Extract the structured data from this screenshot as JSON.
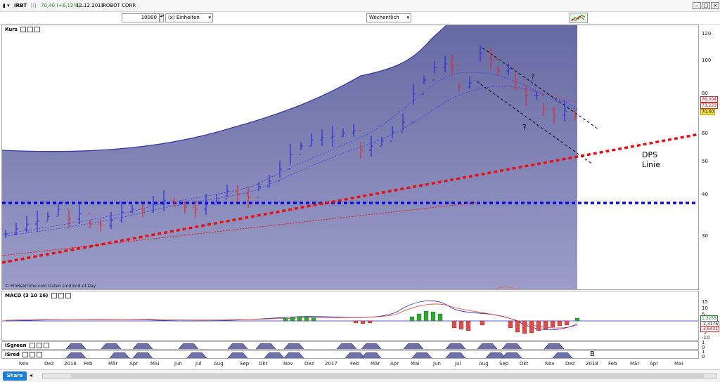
{
  "header": {
    "symbol": "IRBT",
    "price_change": "70,40 (+6,12%)",
    "date": "12.12.2017",
    "company": "IROBOT CORP."
  },
  "toolbar": {
    "quantity": "10000",
    "unit": "(x) Einheiten",
    "period": "Wöchentlich"
  },
  "panels": {
    "price_title": "Kurs",
    "macd_title": "MACD (3 10 16)",
    "isgreen_title": "ISgreen",
    "isred_title": "ISred",
    "source_note": "© ProRealTime.com  Daten sind End-of-Day"
  },
  "annotations": {
    "q1": "?",
    "q2": "?",
    "dps_line1": "DPS",
    "dps_line2": "Linie",
    "b_label": "B"
  },
  "price_axis": [
    "120",
    "100",
    "80",
    "60",
    "50",
    "40",
    "30"
  ],
  "price_labels": {
    "p1": "76,304",
    "p2": "73,223",
    "last": "70,40"
  },
  "macd_axis": [
    "15",
    "10",
    "5",
    "0",
    "-5",
    "-10"
  ],
  "macd_labels": {
    "v1": "1,3255",
    "v2": "-2,3176",
    "v3": "-3,6431"
  },
  "ind_axis": [
    "1",
    "0",
    "1",
    "0"
  ],
  "x_axis": [
    "Nov",
    "Dez",
    "2016",
    "Feb",
    "Mär",
    "Apr",
    "Mai",
    "Jun",
    "Jul",
    "Aug",
    "Sep",
    "Okt",
    "Nov",
    "Dez",
    "2017",
    "Feb",
    "Mär",
    "Apr",
    "Mai",
    "Jun",
    "Jul",
    "Aug",
    "Sep",
    "Okt",
    "Nov",
    "Dez",
    "2018",
    "Feb",
    "Mär",
    "Apr",
    "Mai"
  ],
  "bottom": {
    "share": "Share"
  },
  "colors": {
    "band": "#6f70a8",
    "up": "#2a2ae0",
    "down": "#e02a2a",
    "dps": "#e81010",
    "support": "#0a0ad8"
  }
}
